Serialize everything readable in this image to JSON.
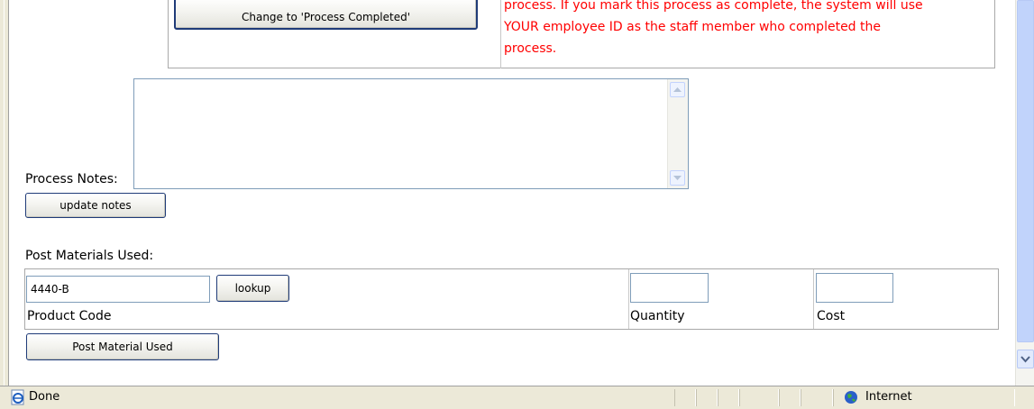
{
  "top_panel": {
    "button_label": "Change to 'Process Completed'",
    "note_lines": [
      "process. If you mark this process as complete, the system will use",
      "YOUR employee ID as the staff member who completed the",
      "process."
    ]
  },
  "notes": {
    "label": "Process Notes:",
    "value": "",
    "update_button": "update notes"
  },
  "materials": {
    "heading": "Post Materials Used:",
    "product_code_value": "4440-B",
    "lookup_button": "lookup",
    "product_code_label": "Product Code",
    "quantity_label": "Quantity",
    "quantity_value": "",
    "cost_label": "Cost",
    "cost_value": "",
    "post_button": "Post Material Used"
  },
  "status_bar": {
    "status_text": "Done",
    "zone_text": "Internet",
    "page_icon": "ie-page-icon",
    "zone_icon": "globe-icon"
  },
  "colors": {
    "warning_text": "#ff0000",
    "button_border": "#1f3b78",
    "statusbar_bg": "#ece9d8"
  }
}
